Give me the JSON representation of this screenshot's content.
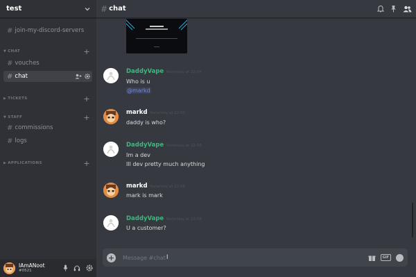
{
  "server": {
    "name": "test"
  },
  "sidebar": {
    "channels_top": [
      {
        "label": "join-my-discord-servers"
      }
    ],
    "categories": [
      {
        "name": "CHAT",
        "channels": [
          {
            "label": "vouches"
          },
          {
            "label": "chat",
            "active": true
          }
        ]
      },
      {
        "name": "TICKETS",
        "channels": []
      },
      {
        "name": "STAFF",
        "channels": [
          {
            "label": "commissions"
          },
          {
            "label": "logs"
          }
        ]
      },
      {
        "name": "APPLICATIONS",
        "channels": []
      }
    ]
  },
  "user": {
    "name": "IAmANoot",
    "tag": "#0521"
  },
  "channel": {
    "title": "chat"
  },
  "messages": [
    {
      "author": "DaddyVape",
      "timestamp": "Yesterday at 22:04",
      "lines": [
        "Who is u"
      ],
      "mention": "@markd"
    },
    {
      "author": "markd",
      "timestamp": "Yesterday at 22:05",
      "lines": [
        "daddy is who?"
      ]
    },
    {
      "author": "DaddyVape",
      "timestamp": "Yesterday at 22:06",
      "lines": [
        "Im a dev",
        "Ill dev pretty much anything"
      ]
    },
    {
      "author": "markd",
      "timestamp": "Yesterday at 22:06",
      "lines": [
        "mark is mark"
      ]
    },
    {
      "author": "DaddyVape",
      "timestamp": "Yesterday at 22:06",
      "lines": [
        "U a customer?"
      ]
    }
  ],
  "composer": {
    "placeholder": "Message #chat",
    "gif_label": "GIF"
  },
  "colors": {
    "green": "#43b581",
    "mention": "#7289da",
    "background": "#36393f",
    "sidebar": "#2f3136"
  }
}
